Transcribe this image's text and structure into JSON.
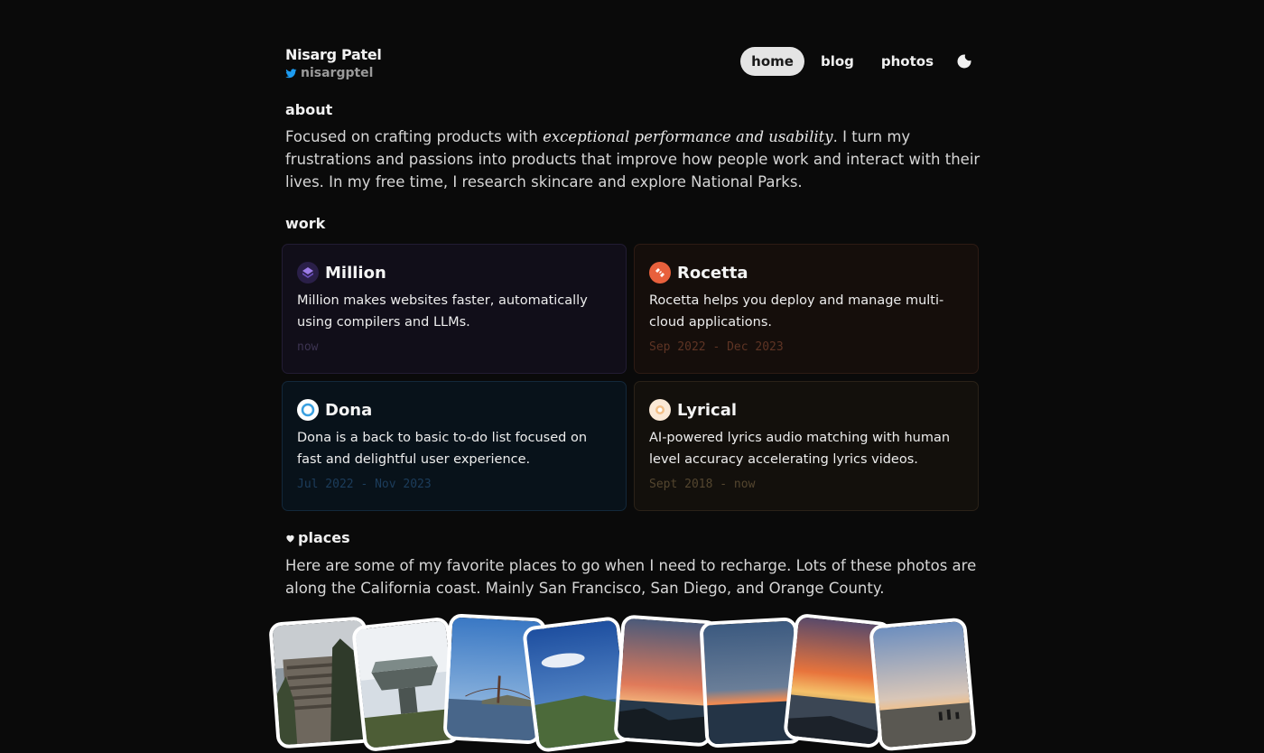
{
  "header": {
    "name": "Nisarg Patel",
    "handle": "nisargptel"
  },
  "nav": {
    "items": [
      {
        "label": "home",
        "active": true
      },
      {
        "label": "blog",
        "active": false
      },
      {
        "label": "photos",
        "active": false
      }
    ],
    "theme_icon": "moon-icon"
  },
  "about": {
    "heading": "about",
    "text_before": "Focused on crafting products with ",
    "emphasis": "exceptional performance and usability",
    "text_after": ". I turn my frustrations and passions into products that improve how people work and interact with their lives. In my free time, I research skincare and explore National Parks."
  },
  "work": {
    "heading": "work",
    "cards": [
      {
        "title": "Million",
        "description": "Million makes websites faster, automatically using compilers and LLMs.",
        "date": "now",
        "icon": "million-logo"
      },
      {
        "title": "Rocetta",
        "description": "Rocetta helps you deploy and manage multi-cloud applications.",
        "date": "Sep 2022 - Dec 2023",
        "icon": "rocetta-logo"
      },
      {
        "title": "Dona",
        "description": "Dona is a back to basic to-do list focused on fast and delightful user experience.",
        "date": "Jul 2022 - Nov 2023",
        "icon": "dona-logo"
      },
      {
        "title": "Lyrical",
        "description": "AI-powered lyrics audio matching with human level accuracy accelerating lyrics videos.",
        "date": "Sept 2018 - now",
        "icon": "lyrical-logo"
      }
    ]
  },
  "places": {
    "heading": "places",
    "heading_icon": "heart-icon",
    "text": "Here are some of my favorite places to go when I need to recharge. Lots of these photos are along the California coast. Mainly San Francisco, San Diego, and Orange County."
  },
  "colors": {
    "background": "#0a0a0a",
    "twitter": "#1d9bf0",
    "million": "#6b4fbb",
    "rocetta": "#e8603c",
    "dona": "#3aa0e0",
    "lyrical": "#f2c089"
  }
}
